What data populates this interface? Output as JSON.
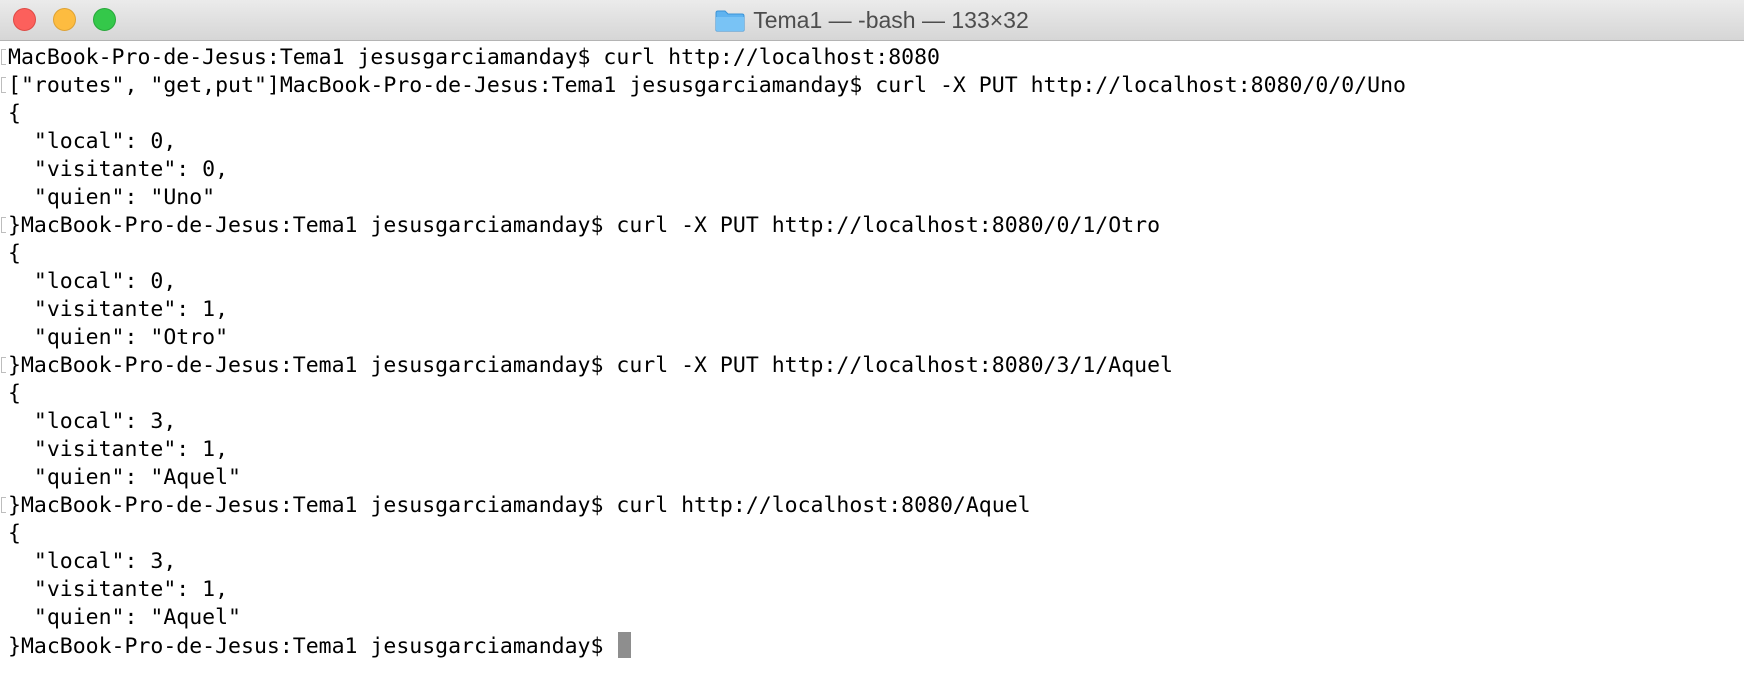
{
  "window": {
    "title": "Tema1 — -bash — 133×32",
    "folder_icon": "folder-icon",
    "traffic_lights": {
      "close": "#fc605c",
      "minimize": "#fdbc40",
      "zoom": "#34c84a"
    }
  },
  "terminal": {
    "lines": [
      "MacBook-Pro-de-Jesus:Tema1 jesusgarciamanday$ curl http://localhost:8080",
      "[\"routes\", \"get,put\"]MacBook-Pro-de-Jesus:Tema1 jesusgarciamanday$ curl -X PUT http://localhost:8080/0/0/Uno",
      "{",
      "  \"local\": 0,",
      "  \"visitante\": 0,",
      "  \"quien\": \"Uno\"",
      "}MacBook-Pro-de-Jesus:Tema1 jesusgarciamanday$ curl -X PUT http://localhost:8080/0/1/Otro",
      "{",
      "  \"local\": 0,",
      "  \"visitante\": 1,",
      "  \"quien\": \"Otro\"",
      "}MacBook-Pro-de-Jesus:Tema1 jesusgarciamanday$ curl -X PUT http://localhost:8080/3/1/Aquel",
      "{",
      "  \"local\": 3,",
      "  \"visitante\": 1,",
      "  \"quien\": \"Aquel\"",
      "}MacBook-Pro-de-Jesus:Tema1 jesusgarciamanday$ curl http://localhost:8080/Aquel",
      "{",
      "  \"local\": 3,",
      "  \"visitante\": 1,",
      "  \"quien\": \"Aquel\"",
      "}MacBook-Pro-de-Jesus:Tema1 jesusgarciamanday$ "
    ],
    "marked_lines": [
      0,
      1,
      6,
      11,
      16
    ],
    "cursor_color": "#8e8e8e"
  }
}
